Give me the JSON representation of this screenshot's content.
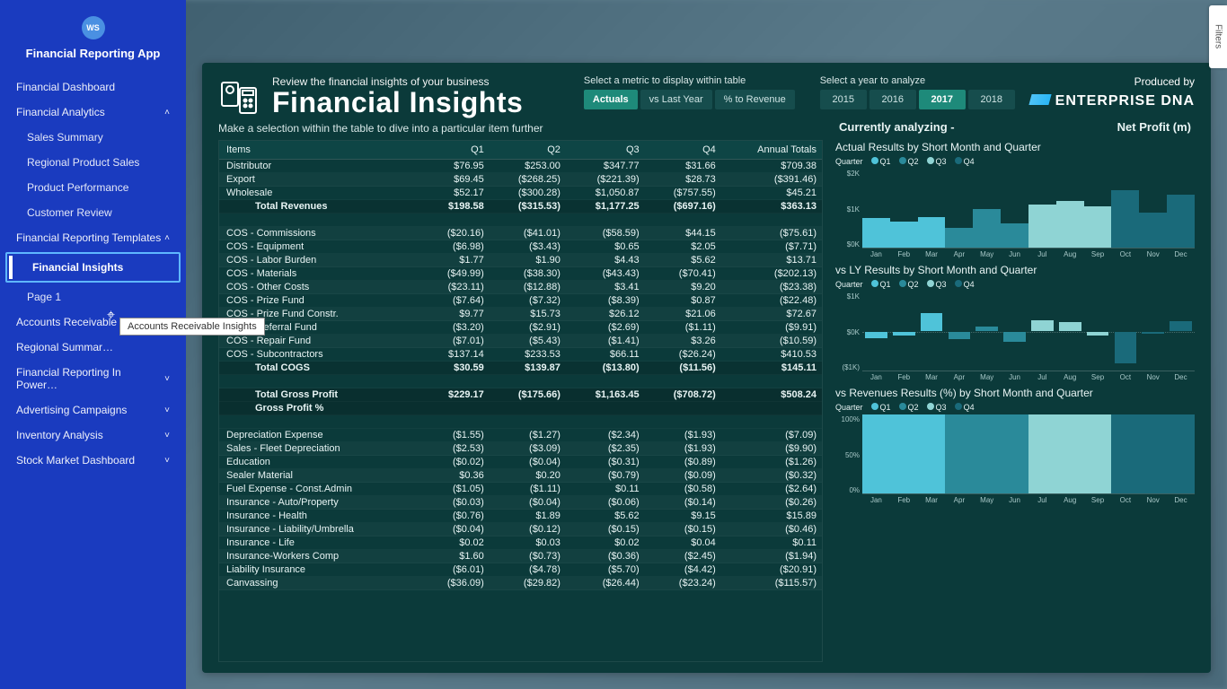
{
  "avatar_initials": "WS",
  "app_title": "Financial Reporting App",
  "sidebar": {
    "items": [
      {
        "label": "Financial Dashboard",
        "kind": "item"
      },
      {
        "label": "Financial Analytics",
        "kind": "group",
        "open": true
      },
      {
        "label": "Sales Summary",
        "kind": "sub"
      },
      {
        "label": "Regional Product Sales",
        "kind": "sub"
      },
      {
        "label": "Product Performance",
        "kind": "sub"
      },
      {
        "label": "Customer Review",
        "kind": "sub"
      },
      {
        "label": "Financial Reporting Templates",
        "kind": "group",
        "open": true
      },
      {
        "label": "Financial Insights",
        "kind": "selected"
      },
      {
        "label": "Page 1",
        "kind": "sub"
      },
      {
        "label": "Accounts Receivable Insights",
        "kind": "group",
        "open": false
      },
      {
        "label": "Regional Summar…",
        "kind": "item-trunc"
      },
      {
        "label": "Financial Reporting In Power…",
        "kind": "group",
        "open": false
      },
      {
        "label": "Advertising Campaigns",
        "kind": "group",
        "open": false
      },
      {
        "label": "Inventory Analysis",
        "kind": "group",
        "open": false
      },
      {
        "label": "Stock Market Dashboard",
        "kind": "group",
        "open": false
      }
    ]
  },
  "tooltip": "Accounts Receivable Insights",
  "header": {
    "sub": "Review the financial insights of your business",
    "title": "Financial Insights",
    "metric_label": "Select a metric to display within table",
    "metrics": [
      "Actuals",
      "vs Last Year",
      "% to Revenue"
    ],
    "metric_active": "Actuals",
    "year_label": "Select a year to analyze",
    "years": [
      "2015",
      "2016",
      "2017",
      "2018"
    ],
    "year_active": "2017",
    "produced": "Produced by",
    "brand": "ENTERPRISE DNA"
  },
  "table": {
    "instruction": "Make a selection within the table to dive into a particular item further",
    "cols": [
      "Items",
      "Q1",
      "Q2",
      "Q3",
      "Q4",
      "Annual Totals"
    ],
    "rows": [
      {
        "c": [
          "Distributor",
          "$76.95",
          "$253.00",
          "$347.77",
          "$31.66",
          "$709.38"
        ],
        "t": "r"
      },
      {
        "c": [
          "Export",
          "$69.45",
          "($268.25)",
          "($221.39)",
          "$28.73",
          "($391.46)"
        ],
        "t": "r"
      },
      {
        "c": [
          "Wholesale",
          "$52.17",
          "($300.28)",
          "$1,050.87",
          "($757.55)",
          "$45.21"
        ],
        "t": "r"
      },
      {
        "c": [
          "Total Revenues",
          "$198.58",
          "($315.53)",
          "$1,177.25",
          "($697.16)",
          "$363.13"
        ],
        "t": "total",
        "i": 2
      },
      {
        "c": [
          "",
          "",
          "",
          "",
          "",
          ""
        ],
        "t": "blank"
      },
      {
        "c": [
          "COS - Commissions",
          "($20.16)",
          "($41.01)",
          "($58.59)",
          "$44.15",
          "($75.61)"
        ],
        "t": "r"
      },
      {
        "c": [
          "COS - Equipment",
          "($6.98)",
          "($3.43)",
          "$0.65",
          "$2.05",
          "($7.71)"
        ],
        "t": "r"
      },
      {
        "c": [
          "COS - Labor Burden",
          "$1.77",
          "$1.90",
          "$4.43",
          "$5.62",
          "$13.71"
        ],
        "t": "r"
      },
      {
        "c": [
          "COS - Materials",
          "($49.99)",
          "($38.30)",
          "($43.43)",
          "($70.41)",
          "($202.13)"
        ],
        "t": "r"
      },
      {
        "c": [
          "COS - Other Costs",
          "($23.11)",
          "($12.88)",
          "$3.41",
          "$9.20",
          "($23.38)"
        ],
        "t": "r"
      },
      {
        "c": [
          "COS - Prize Fund",
          "($7.64)",
          "($7.32)",
          "($8.39)",
          "$0.87",
          "($22.48)"
        ],
        "t": "r"
      },
      {
        "c": [
          "COS - Prize Fund Constr.",
          "$9.77",
          "$15.73",
          "$26.12",
          "$21.06",
          "$72.67"
        ],
        "t": "r"
      },
      {
        "c": [
          "COS - Referral Fund",
          "($3.20)",
          "($2.91)",
          "($2.69)",
          "($1.11)",
          "($9.91)"
        ],
        "t": "r"
      },
      {
        "c": [
          "COS - Repair Fund",
          "($7.01)",
          "($5.43)",
          "($1.41)",
          "$3.26",
          "($10.59)"
        ],
        "t": "r"
      },
      {
        "c": [
          "COS - Subcontractors",
          "$137.14",
          "$233.53",
          "$66.11",
          "($26.24)",
          "$410.53"
        ],
        "t": "r"
      },
      {
        "c": [
          "Total COGS",
          "$30.59",
          "$139.87",
          "($13.80)",
          "($11.56)",
          "$145.11"
        ],
        "t": "total",
        "i": 2
      },
      {
        "c": [
          "",
          "",
          "",
          "",
          "",
          ""
        ],
        "t": "blank"
      },
      {
        "c": [
          "Total Gross Profit",
          "$229.17",
          "($175.66)",
          "$1,163.45",
          "($708.72)",
          "$508.24"
        ],
        "t": "gross",
        "i": 2
      },
      {
        "c": [
          "Gross Profit %",
          "",
          "",
          "",
          "",
          ""
        ],
        "t": "gross",
        "i": 2
      },
      {
        "c": [
          "",
          "",
          "",
          "",
          "",
          ""
        ],
        "t": "blank"
      },
      {
        "c": [
          "Depreciation Expense",
          "($1.55)",
          "($1.27)",
          "($2.34)",
          "($1.93)",
          "($7.09)"
        ],
        "t": "r"
      },
      {
        "c": [
          "Sales - Fleet Depreciation",
          "($2.53)",
          "($3.09)",
          "($2.35)",
          "($1.93)",
          "($9.90)"
        ],
        "t": "r"
      },
      {
        "c": [
          "Education",
          "($0.02)",
          "($0.04)",
          "($0.31)",
          "($0.89)",
          "($1.26)"
        ],
        "t": "r"
      },
      {
        "c": [
          "Sealer Material",
          "$0.36",
          "$0.20",
          "($0.79)",
          "($0.09)",
          "($0.32)"
        ],
        "t": "r"
      },
      {
        "c": [
          "Fuel Expense - Const.Admin",
          "($1.05)",
          "($1.11)",
          "$0.11",
          "($0.58)",
          "($2.64)"
        ],
        "t": "r"
      },
      {
        "c": [
          "Insurance - Auto/Property",
          "($0.03)",
          "($0.04)",
          "($0.06)",
          "($0.14)",
          "($0.26)"
        ],
        "t": "r"
      },
      {
        "c": [
          "Insurance - Health",
          "($0.76)",
          "$1.89",
          "$5.62",
          "$9.15",
          "$15.89"
        ],
        "t": "r"
      },
      {
        "c": [
          "Insurance - Liability/Umbrella",
          "($0.04)",
          "($0.12)",
          "($0.15)",
          "($0.15)",
          "($0.46)"
        ],
        "t": "r"
      },
      {
        "c": [
          "Insurance - Life",
          "$0.02",
          "$0.03",
          "$0.02",
          "$0.04",
          "$0.11"
        ],
        "t": "r"
      },
      {
        "c": [
          "Insurance-Workers Comp",
          "$1.60",
          "($0.73)",
          "($0.36)",
          "($2.45)",
          "($1.94)"
        ],
        "t": "r"
      },
      {
        "c": [
          "Liability Insurance",
          "($6.01)",
          "($4.78)",
          "($5.70)",
          "($4.42)",
          "($20.91)"
        ],
        "t": "r"
      },
      {
        "c": [
          "Canvassing",
          "($36.09)",
          "($29.82)",
          "($26.44)",
          "($23.24)",
          "($115.57)"
        ],
        "t": "r"
      }
    ]
  },
  "analyzing": {
    "label": "Currently analyzing -",
    "metric": "Net Profit (m)"
  },
  "legend_label": "Quarter",
  "months": [
    "Jan",
    "Feb",
    "Mar",
    "Apr",
    "May",
    "Jun",
    "Jul",
    "Aug",
    "Sep",
    "Oct",
    "Nov",
    "Dec"
  ],
  "quarters": [
    "Q1",
    "Q2",
    "Q3",
    "Q4"
  ],
  "q_colors": [
    "#4fc3d9",
    "#2a8a9a",
    "#8fd4d4",
    "#1a6a7a"
  ],
  "chart1": {
    "title": "Actual Results by Short Month and Quarter",
    "yticks": [
      "$2K",
      "$1K",
      "$0K"
    ],
    "values": [
      750,
      650,
      780,
      500,
      980,
      620,
      1100,
      1180,
      1050,
      1450,
      880,
      1350
    ]
  },
  "chart2": {
    "title": "vs LY Results by Short Month and Quarter",
    "yticks": [
      "$1K",
      "$0K",
      "($1K)"
    ],
    "values": [
      -150,
      -100,
      450,
      -180,
      120,
      -250,
      280,
      220,
      -100,
      -800,
      -50,
      250
    ]
  },
  "chart3": {
    "title": "vs Revenues Results (%) by Short Month and Quarter",
    "yticks": [
      "100%",
      "50%",
      "0%"
    ],
    "values": [
      100,
      100,
      100,
      100,
      100,
      100,
      100,
      100,
      100,
      100,
      100,
      100
    ]
  },
  "chart_data": [
    {
      "type": "bar",
      "title": "Actual Results by Short Month and Quarter",
      "categories": [
        "Jan",
        "Feb",
        "Mar",
        "Apr",
        "May",
        "Jun",
        "Jul",
        "Aug",
        "Sep",
        "Oct",
        "Nov",
        "Dec"
      ],
      "values": [
        750,
        650,
        780,
        500,
        980,
        620,
        1100,
        1180,
        1050,
        1450,
        880,
        1350
      ],
      "ylabel": "$",
      "ylim": [
        0,
        2000
      ],
      "color_by": "quarter"
    },
    {
      "type": "bar",
      "title": "vs LY Results by Short Month and Quarter",
      "categories": [
        "Jan",
        "Feb",
        "Mar",
        "Apr",
        "May",
        "Jun",
        "Jul",
        "Aug",
        "Sep",
        "Oct",
        "Nov",
        "Dec"
      ],
      "values": [
        -150,
        -100,
        450,
        -180,
        120,
        -250,
        280,
        220,
        -100,
        -800,
        -50,
        250
      ],
      "ylabel": "$",
      "ylim": [
        -1000,
        1000
      ],
      "color_by": "quarter"
    },
    {
      "type": "bar",
      "title": "vs Revenues Results (%) by Short Month and Quarter",
      "categories": [
        "Jan",
        "Feb",
        "Mar",
        "Apr",
        "May",
        "Jun",
        "Jul",
        "Aug",
        "Sep",
        "Oct",
        "Nov",
        "Dec"
      ],
      "values": [
        100,
        100,
        100,
        100,
        100,
        100,
        100,
        100,
        100,
        100,
        100,
        100
      ],
      "ylabel": "%",
      "ylim": [
        0,
        100
      ],
      "color_by": "quarter"
    }
  ],
  "filters_tab": "Filters"
}
